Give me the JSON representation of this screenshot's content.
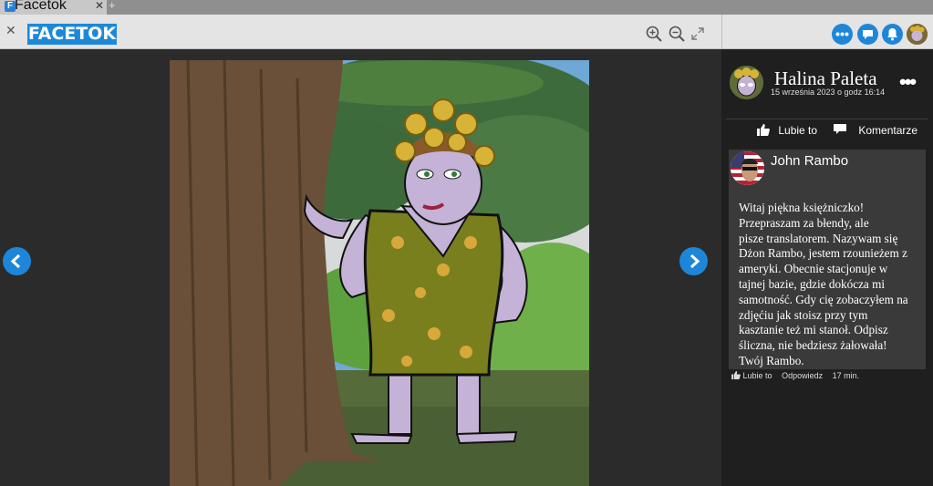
{
  "browser": {
    "tab_title": "Facetok",
    "tab_favicon": "F",
    "tab_close": "✕",
    "new_tab": "+"
  },
  "toolbar": {
    "close_label": "✕",
    "logo": "FACETOK",
    "zoom_in_icon": "zoom-in-icon",
    "zoom_out_icon": "zoom-out-icon",
    "fullscreen_icon": "fullscreen-icon"
  },
  "top_right": {
    "buttons": [
      "more-icon",
      "chat-icon",
      "bell-icon"
    ]
  },
  "colors": {
    "accent": "#1d86d9",
    "panel": "#1f1f1f",
    "comment_bg": "#3a3a3a"
  },
  "post": {
    "author": "Halina Paleta",
    "date": "15 września 2023 o godz 16:14",
    "menu": "•••",
    "like_label": "Lubie to",
    "comments_label": "Komentarze"
  },
  "comment": {
    "author": "John Rambo",
    "text": "Witaj piękna księżniczko!\nPrzepraszam za błendy, ale\npisze translatorem. Nazywam się\nDżon Rambo, jestem rzounieżem z\nameryki. Obecnie stacjonuje w\ntajnej bazie, gdzie dokócza mi\nsamotność. Gdy cię zobaczyłem na\nzdjęćiu jak stoisz przy tym\nkasztanie też mi stanoł. Odpisz\nśliczna, nie bedziesz żałowała!\nTwój Rambo.",
    "like_label": "Lubie to",
    "reply_label": "Odpowiedz",
    "time": "17 min."
  }
}
